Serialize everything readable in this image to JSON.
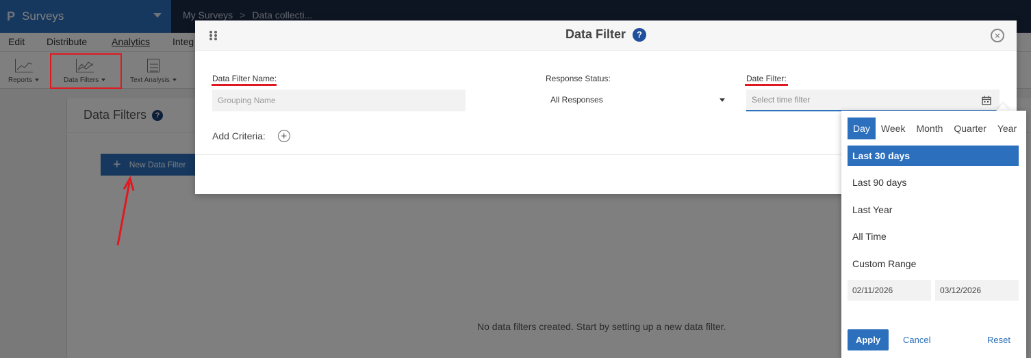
{
  "app": {
    "logo": "P",
    "title": "Surveys"
  },
  "breadcrumb": {
    "item1": "My Surveys",
    "sep": ">",
    "item2": "Data collecti..."
  },
  "menubar": {
    "edit": "Edit",
    "distribute": "Distribute",
    "analytics": "Analytics",
    "integrations": "Integ"
  },
  "toolbar": {
    "reports": "Reports",
    "data_filters": "Data Filters",
    "text_analysis": "Text Analysis"
  },
  "page": {
    "title": "Data Filters",
    "help": "?",
    "new_filter_label": "New Data Filter",
    "plus": "+",
    "empty_message": "No data filters created. Start by setting up a new data filter."
  },
  "modal": {
    "title": "Data Filter",
    "help": "?",
    "close": "×",
    "name_label": "Data Filter Name:",
    "name_placeholder": "Grouping Name",
    "status_label": "Response Status:",
    "status_value": "All Responses",
    "date_label": "Date Filter:",
    "date_placeholder": "Select time filter",
    "add_criteria_label": "Add Criteria:",
    "add_plus": "+"
  },
  "picker": {
    "tabs": [
      "Day",
      "Week",
      "Month",
      "Quarter",
      "Year"
    ],
    "active_tab": "Day",
    "options": [
      "Last 30 days",
      "Last 90 days",
      "Last Year",
      "All Time",
      "Custom Range"
    ],
    "active_option": "Last 30 days",
    "start_date": "02/11/2026",
    "end_date": "03/12/2026",
    "apply": "Apply",
    "cancel": "Cancel",
    "reset": "Reset"
  },
  "colors": {
    "primary": "#2c6fbd",
    "topbar": "#1c2a45",
    "annotation_red": "#e0191f"
  }
}
